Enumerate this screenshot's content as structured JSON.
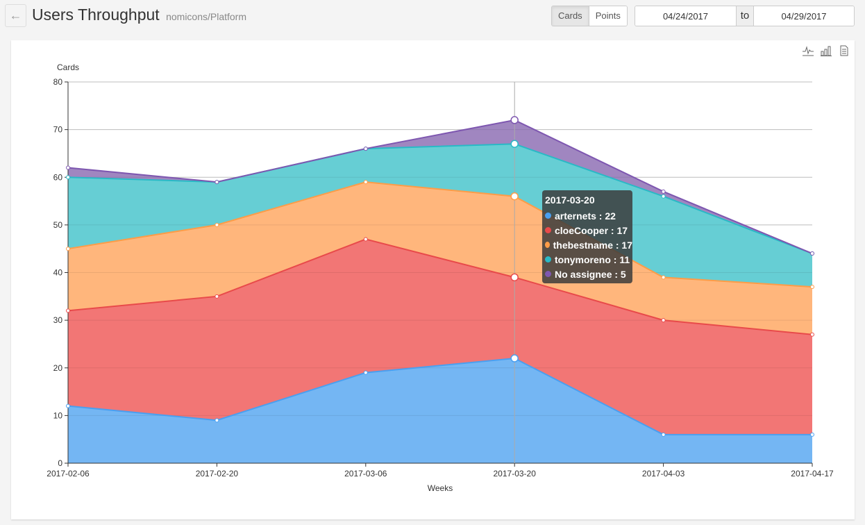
{
  "header": {
    "back_icon": "arrow-left-icon",
    "title": "Users Throughput",
    "subtitle": "nomicons/Platform",
    "mode_options": [
      "Cards",
      "Points"
    ],
    "mode_selected": "Cards",
    "date_from": "04/24/2017",
    "date_to_label": "to",
    "date_to": "04/29/2017"
  },
  "toolbox": {
    "icons": [
      "line-chart-icon",
      "bar-chart-icon",
      "data-view-icon"
    ]
  },
  "chart_data": {
    "type": "area",
    "stacked": true,
    "title": "",
    "xlabel": "Weeks",
    "ylabel": "Cards",
    "ylim": [
      0,
      80
    ],
    "yticks": [
      0,
      10,
      20,
      30,
      40,
      50,
      60,
      70,
      80
    ],
    "grid": true,
    "x": [
      "2017-02-06",
      "2017-02-20",
      "2017-03-06",
      "2017-03-20",
      "2017-04-03",
      "2017-04-17"
    ],
    "series": [
      {
        "name": "arternets",
        "color": "#4a9ff0",
        "fill": "#74b6f3",
        "values": [
          12,
          9,
          19,
          22,
          6,
          6
        ]
      },
      {
        "name": "cloeCooper",
        "color": "#e84a4a",
        "fill": "#f27675",
        "values": [
          20,
          26,
          28,
          17,
          24,
          21
        ]
      },
      {
        "name": "thebestname",
        "color": "#ff9c47",
        "fill": "#ffb67c",
        "values": [
          13,
          15,
          12,
          17,
          9,
          10
        ]
      },
      {
        "name": "tonymoreno",
        "color": "#29b9c6",
        "fill": "#66ced4",
        "values": [
          15,
          9,
          7,
          11,
          17,
          7
        ]
      },
      {
        "name": "No assignee",
        "color": "#7e57b0",
        "fill": "#a086c0",
        "values": [
          2,
          0,
          0,
          5,
          1,
          0
        ]
      }
    ],
    "tooltip": {
      "x": "2017-03-20",
      "rows": [
        {
          "name": "arternets",
          "value": 22,
          "label": "arternets : 22"
        },
        {
          "name": "cloeCooper",
          "value": 17,
          "label": "cloeCooper : 17"
        },
        {
          "name": "thebestname",
          "value": 17,
          "label": "thebestname : 17"
        },
        {
          "name": "tonymoreno",
          "value": 11,
          "label": "tonymoreno : 11"
        },
        {
          "name": "No assignee",
          "value": 5,
          "label": "No assignee : 5"
        }
      ]
    }
  }
}
